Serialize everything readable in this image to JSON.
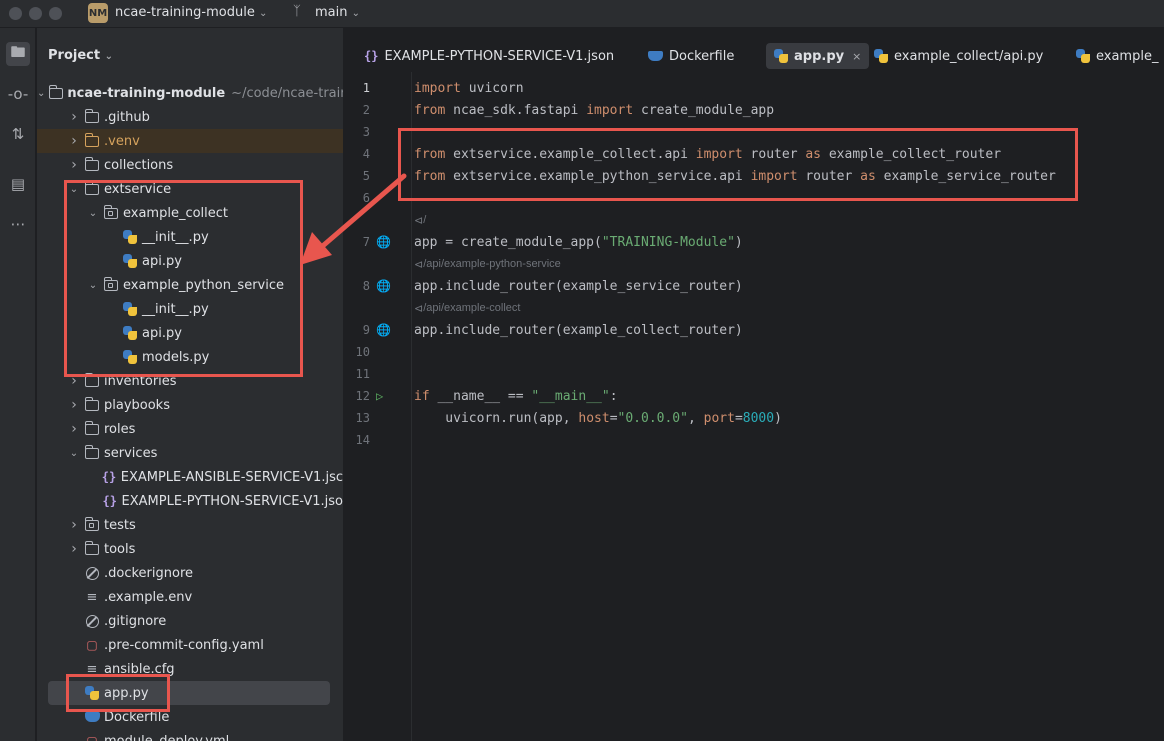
{
  "titlebar": {
    "project_badge": "NM",
    "project_name": "ncae-training-module",
    "branch": "main"
  },
  "panel": {
    "title": "Project"
  },
  "tree": [
    {
      "label": "ncae-training-module",
      "path": "~/code/ncae-trair",
      "type": "folder",
      "depth": 0,
      "arrow": "down"
    },
    {
      "label": ".github",
      "type": "folder",
      "depth": 1,
      "arrow": "right"
    },
    {
      "label": ".venv",
      "type": "folder-orange",
      "depth": 1,
      "arrow": "right"
    },
    {
      "label": "collections",
      "type": "folder",
      "depth": 1,
      "arrow": "right"
    },
    {
      "label": "extservice",
      "type": "folder",
      "depth": 1,
      "arrow": "down"
    },
    {
      "label": "example_collect",
      "type": "package",
      "depth": 2,
      "arrow": "down"
    },
    {
      "label": "__init__.py",
      "type": "py",
      "depth": 3
    },
    {
      "label": "api.py",
      "type": "py",
      "depth": 3
    },
    {
      "label": "example_python_service",
      "type": "package",
      "depth": 2,
      "arrow": "down"
    },
    {
      "label": "__init__.py",
      "type": "py",
      "depth": 3
    },
    {
      "label": "api.py",
      "type": "py",
      "depth": 3
    },
    {
      "label": "models.py",
      "type": "py",
      "depth": 3
    },
    {
      "label": "inventories",
      "type": "folder",
      "depth": 1,
      "arrow": "right"
    },
    {
      "label": "playbooks",
      "type": "folder",
      "depth": 1,
      "arrow": "right"
    },
    {
      "label": "roles",
      "type": "folder",
      "depth": 1,
      "arrow": "right"
    },
    {
      "label": "services",
      "type": "folder",
      "depth": 1,
      "arrow": "down"
    },
    {
      "label": "EXAMPLE-ANSIBLE-SERVICE-V1.jsc",
      "type": "json",
      "depth": 2
    },
    {
      "label": "EXAMPLE-PYTHON-SERVICE-V1.jso",
      "type": "json",
      "depth": 2
    },
    {
      "label": "tests",
      "type": "package",
      "depth": 1,
      "arrow": "right"
    },
    {
      "label": "tools",
      "type": "folder",
      "depth": 1,
      "arrow": "right"
    },
    {
      "label": ".dockerignore",
      "type": "ignore",
      "depth": 1
    },
    {
      "label": ".example.env",
      "type": "lines",
      "depth": 1
    },
    {
      "label": ".gitignore",
      "type": "ignore",
      "depth": 1
    },
    {
      "label": ".pre-commit-config.yaml",
      "type": "yaml",
      "depth": 1
    },
    {
      "label": "ansible.cfg",
      "type": "cfg",
      "depth": 1
    },
    {
      "label": "app.py",
      "type": "py",
      "depth": 1,
      "selected": true
    },
    {
      "label": "Dockerfile",
      "type": "docker",
      "depth": 1
    },
    {
      "label": "module_deploy.yml",
      "type": "yaml",
      "depth": 1
    }
  ],
  "tabs": [
    {
      "label": "EXAMPLE-PYTHON-SERVICE-V1.json",
      "type": "json"
    },
    {
      "label": "Dockerfile",
      "type": "docker"
    },
    {
      "label": "app.py",
      "type": "py",
      "active": true
    },
    {
      "label": "example_collect/api.py",
      "type": "py"
    },
    {
      "label": "example_",
      "type": "py"
    }
  ],
  "hints": {
    "root": "/",
    "service": "/api/example-python-service",
    "collect": "/api/example-collect"
  },
  "code": {
    "l1": {
      "n": "1",
      "kw1": "import",
      "t1": " uvicorn"
    },
    "l2": {
      "n": "2",
      "kw1": "from",
      "t1": " ncae_sdk.fastapi ",
      "kw2": "import",
      "t2": " create_module_app"
    },
    "l3": {
      "n": "3"
    },
    "l4": {
      "n": "4",
      "kw1": "from",
      "t1": " extservice.example_collect.api ",
      "kw2": "import",
      "t2": " router ",
      "kw3": "as",
      "t3": " example_collect_router"
    },
    "l5": {
      "n": "5",
      "kw1": "from",
      "t1": " extservice.example_python_service.api ",
      "kw2": "import",
      "t2": " router ",
      "kw3": "as",
      "t3": " example_service_router"
    },
    "l6": {
      "n": "6"
    },
    "l7": {
      "n": "7",
      "t1": "app = create_module_app(",
      "s1": "\"TRAINING-Module\"",
      "t2": ")"
    },
    "l8": {
      "n": "8",
      "t1": "app.include_router(example_service_router)"
    },
    "l9": {
      "n": "9",
      "t1": "app.include_router(example_collect_router)"
    },
    "l10": {
      "n": "10"
    },
    "l11": {
      "n": "11"
    },
    "l12": {
      "n": "12",
      "kw1": "if",
      "t1": " __name__ == ",
      "s1": "\"__main__\"",
      "t2": ":"
    },
    "l13": {
      "n": "13",
      "t1": "    uvicorn.run(app, ",
      "p1": "host",
      "t2": "=",
      "s1": "\"0.0.0.0\"",
      "t3": ", ",
      "p2": "port",
      "t4": "=",
      "n1": "8000",
      "t5": ")"
    },
    "l14": {
      "n": "14"
    }
  }
}
